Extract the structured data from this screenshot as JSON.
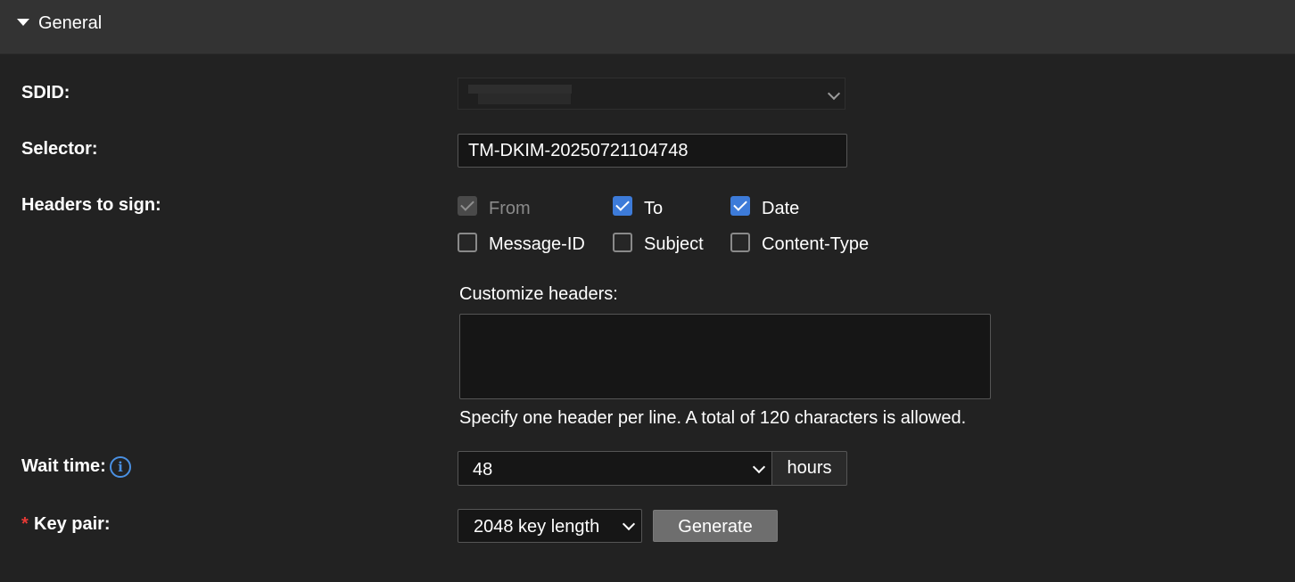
{
  "section": {
    "title": "General",
    "caret_icon": "caret-down-icon"
  },
  "fields": {
    "sdid": {
      "label": "SDID:"
    },
    "selector": {
      "label": "Selector:",
      "value": "TM-DKIM-20250721104748"
    },
    "headers": {
      "label": "Headers to sign:",
      "options": [
        {
          "label": "From",
          "checked": true,
          "disabled": true
        },
        {
          "label": "To",
          "checked": true,
          "disabled": false
        },
        {
          "label": "Date",
          "checked": true,
          "disabled": false
        },
        {
          "label": "Message-ID",
          "checked": false,
          "disabled": false
        },
        {
          "label": "Subject",
          "checked": false,
          "disabled": false
        },
        {
          "label": "Content-Type",
          "checked": false,
          "disabled": false
        }
      ],
      "customize_label": "Customize headers:",
      "customize_value": "",
      "hint": "Specify one header per line. A total of 120 characters is allowed."
    },
    "wait_time": {
      "label": "Wait time:",
      "value": "48",
      "unit": "hours",
      "info_icon": "info-icon"
    },
    "key_pair": {
      "label": "Key pair:",
      "required_mark": "*",
      "value": "2048 key length",
      "button": "Generate"
    }
  },
  "colors": {
    "accent": "#3d7bd9",
    "required": "#e53935",
    "info": "#4a90e2",
    "background": "#222222",
    "header": "#333333"
  }
}
